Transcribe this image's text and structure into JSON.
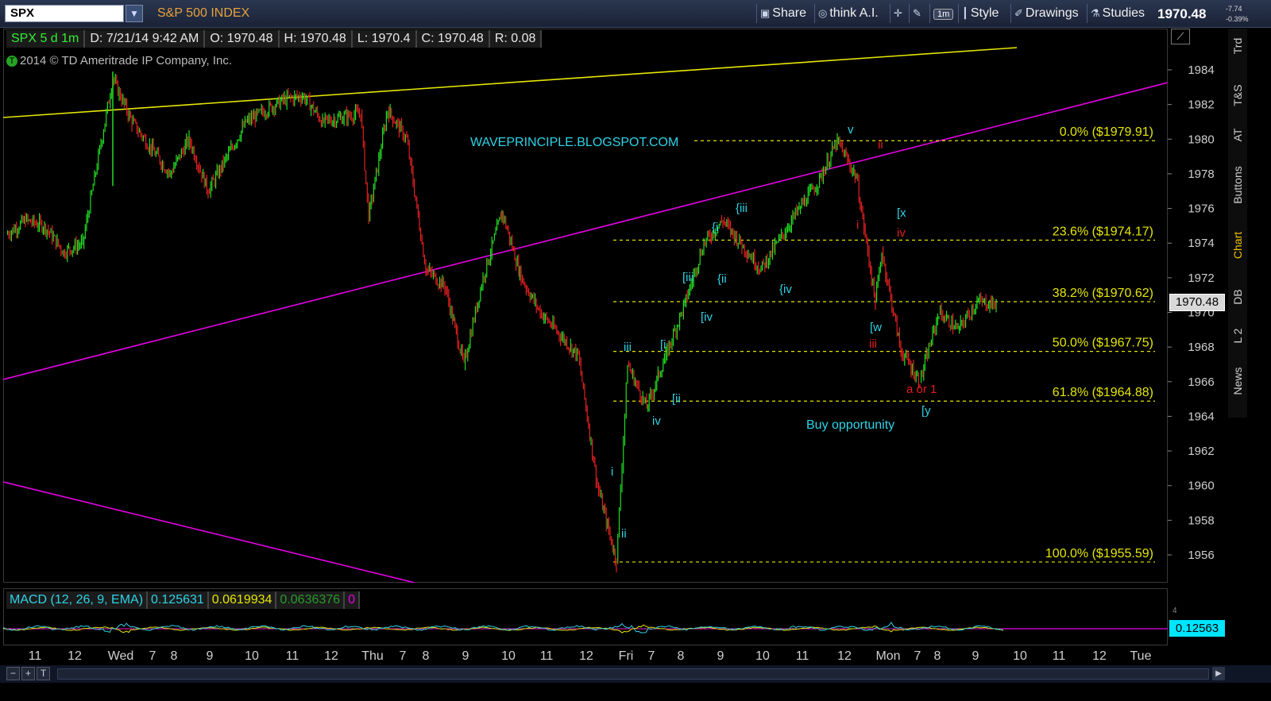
{
  "toolbar": {
    "symbol": "SPX",
    "instrument_name": "S&P 500 INDEX",
    "share": "Share",
    "think_ai": "think A.I.",
    "timeframe": "1m",
    "style": "Style",
    "drawings": "Drawings",
    "studies": "Studies",
    "last_price": "1970.48",
    "net_change": "-7.74",
    "pct_change": "-0.39%"
  },
  "info_bar": {
    "symbol_period": "SPX 5 d 1m",
    "date": "D: 7/21/14 9:42 AM",
    "open": "O: 1970.48",
    "high": "H: 1970.48",
    "low": "L: 1970.4",
    "close": "C: 1970.48",
    "range": "R: 0.08"
  },
  "copyright": "2014 © TD Ameritrade IP Company, Inc.",
  "watermark": "WAVEPRINCIPLE.BLOGSPOT.COM",
  "price_axis": {
    "ticks": [
      "1984",
      "1982",
      "1980",
      "1978",
      "1976",
      "1974",
      "1972",
      "1970",
      "1968",
      "1966",
      "1964",
      "1962",
      "1960",
      "1958",
      "1956"
    ],
    "current_price_tag": "1970.48"
  },
  "side_tabs": [
    "Trd",
    "T&S",
    "AT",
    "Buttons",
    "Chart",
    "DB",
    "L 2",
    "News"
  ],
  "macd": {
    "label": "MACD (12, 26, 9, EMA)",
    "value": "0.125631",
    "avg": "0.0619934",
    "diff": "0.0636376",
    "zero": "0",
    "tag": "0.12563",
    "axis_top": "4"
  },
  "time_axis": [
    "11",
    "12",
    "Wed",
    "7",
    "8",
    "9",
    "10",
    "11",
    "12",
    "Thu",
    "7",
    "8",
    "9",
    "10",
    "11",
    "12",
    "Fri",
    "7",
    "8",
    "9",
    "10",
    "11",
    "12",
    "Mon",
    "7",
    "8",
    "9",
    "10",
    "11",
    "12",
    "Tue"
  ],
  "annotations": {
    "buy_opportunity": "Buy opportunity",
    "a_or_1": "a or 1"
  },
  "chart_data": {
    "type": "candlestick",
    "title": "S&P 500 INDEX",
    "symbol": "SPX",
    "interval": "1m",
    "ylim": [
      1955,
      1985.5
    ],
    "fib_levels": [
      {
        "pct": "0.0%",
        "price": 1979.91,
        "label": "0.0%  ($1979.91)"
      },
      {
        "pct": "23.6%",
        "price": 1974.17,
        "label": "23.6%  ($1974.17)"
      },
      {
        "pct": "38.2%",
        "price": 1970.62,
        "label": "38.2%  ($1970.62)"
      },
      {
        "pct": "50.0%",
        "price": 1967.75,
        "label": "50.0%  ($1967.75)"
      },
      {
        "pct": "61.8%",
        "price": 1964.88,
        "label": "61.8%  ($1964.88)"
      },
      {
        "pct": "100.0%",
        "price": 1955.59,
        "label": "100.0%  ($1955.59)"
      }
    ],
    "wave_labels_cyan": [
      "v",
      "[x",
      "{iii",
      "{i",
      "{ii",
      "{iv",
      "[iii",
      "[iv",
      "[i",
      "[ii",
      "iii",
      "iv",
      "i",
      "ii",
      "[w",
      "[y"
    ],
    "wave_labels_red": [
      "ii",
      "i",
      "iv",
      "iii",
      "a or 1"
    ],
    "price_path": [
      [
        "Tue 10:00",
        1974.5
      ],
      [
        "Tue 10:30",
        1975.3
      ],
      [
        "Tue 11:00",
        1975.0
      ],
      [
        "Tue 11:30",
        1973.5
      ],
      [
        "Tue 12:00",
        1974.0
      ],
      [
        "Wed 6:30",
        1983.5
      ],
      [
        "Wed 7:00",
        1981.0
      ],
      [
        "Wed 8:00",
        1978.0
      ],
      [
        "Wed 8:30",
        1980.0
      ],
      [
        "Wed 9:00",
        1977.0
      ],
      [
        "Wed 10:00",
        1981.0
      ],
      [
        "Wed 11:00",
        1982.3
      ],
      [
        "Wed 11:30",
        1982.5
      ],
      [
        "Wed 12:00",
        1981.0
      ],
      [
        "Wed 13:00",
        1981.5
      ],
      [
        "Thu 6:30",
        1975.5
      ],
      [
        "Thu 7:00",
        1981.7
      ],
      [
        "Thu 7:30",
        1980.0
      ],
      [
        "Thu 8:00",
        1972.5
      ],
      [
        "Thu 8:30",
        1971.5
      ],
      [
        "Thu 9:00",
        1967.0
      ],
      [
        "Thu 9:30",
        1972.0
      ],
      [
        "Thu 10:00",
        1975.8
      ],
      [
        "Thu 10:30",
        1972.0
      ],
      [
        "Thu 11:00",
        1970.0
      ],
      [
        "Thu 12:00",
        1967.5
      ],
      [
        "Thu 12:30",
        1960.0
      ],
      [
        "Thu 13:00",
        1955.6
      ],
      [
        "Fri 6:30",
        1967.0
      ],
      [
        "Fri 7:00",
        1964.5
      ],
      [
        "Fri 7:30",
        1967.5
      ],
      [
        "Fri 8:00",
        1970.5
      ],
      [
        "Fri 8:30",
        1974.0
      ],
      [
        "Fri 9:00",
        1975.3
      ],
      [
        "Fri 10:00",
        1972.5
      ],
      [
        "Fri 11:00",
        1976.0
      ],
      [
        "Fri 11:30",
        1977.5
      ],
      [
        "Fri 12:00",
        1979.9
      ],
      [
        "Fri 12:30",
        1977.8
      ],
      [
        "Fri 13:00",
        1970.6
      ],
      [
        "Mon 6:30",
        1973.5
      ],
      [
        "Mon 7:00",
        1967.8
      ],
      [
        "Mon 7:30",
        1966.0
      ],
      [
        "Mon 8:00",
        1970.0
      ],
      [
        "Mon 8:30",
        1969.0
      ],
      [
        "Mon 9:00",
        1970.6
      ],
      [
        "Mon 9:30",
        1970.48
      ]
    ],
    "macd_series": {
      "name": "MACD (12, 26, 9, EMA)",
      "value": 0.125631,
      "avg": 0.0619934,
      "diff": 0.0636376
    },
    "grid": false
  }
}
